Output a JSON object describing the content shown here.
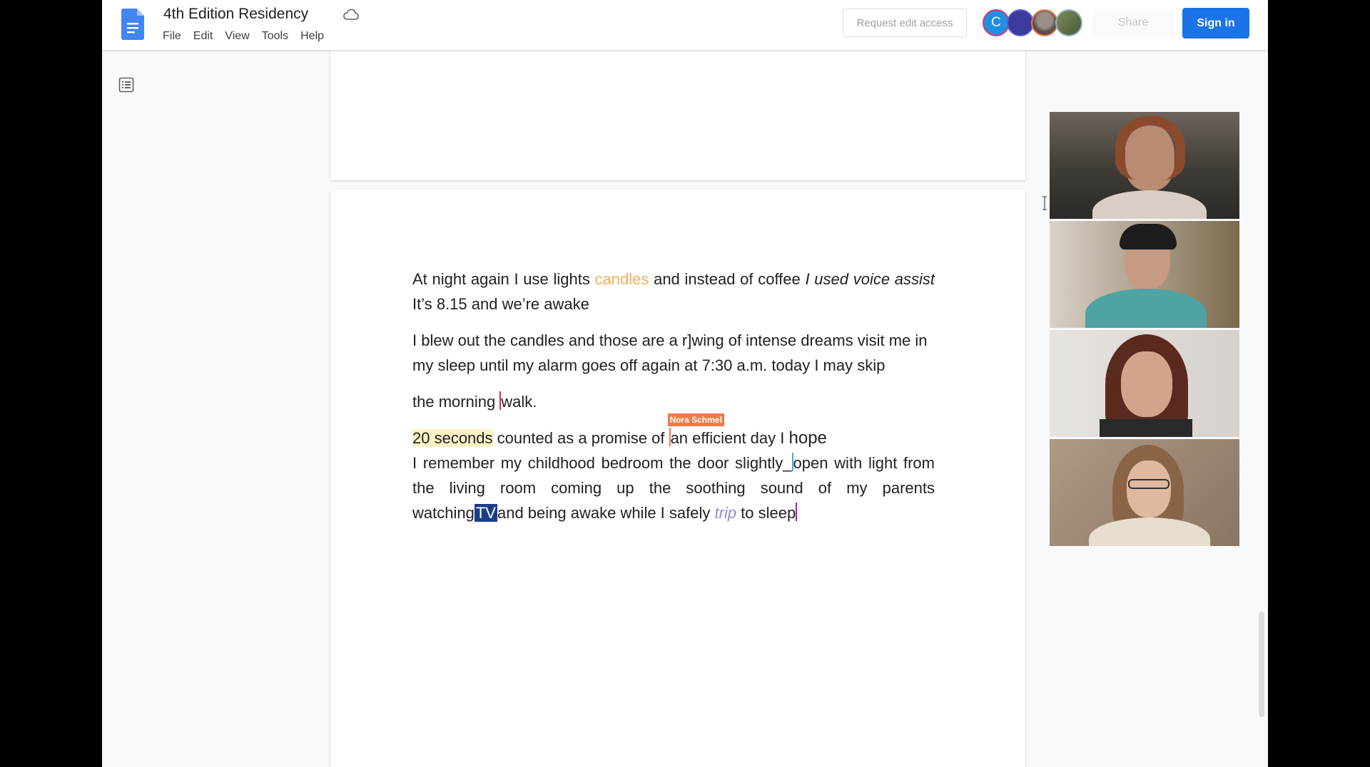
{
  "header": {
    "doc_title": "4th Edition Residency",
    "menu": [
      "File",
      "Edit",
      "View",
      "Tools",
      "Help"
    ],
    "request_edit_label": "Request edit access",
    "share_label": "Share",
    "sign_in_label": "Sign in",
    "avatar_initial": "C",
    "accent": "#1a73e8"
  },
  "document": {
    "p1": {
      "t1": "At night again I use lights ",
      "candles": "candles",
      "t2": " and instead of coffee ",
      "italic": "I used voice assist",
      "t3": " It’s 8.15 and we’re awake"
    },
    "p2": "I blew out the candles and those are a r]wing of intense dreams visit me in my sleep until my alarm goes off again at 7:30 a.m. today I may skip",
    "p3": {
      "a": " the morning ",
      "b": "walk."
    },
    "p4": {
      "highlight": "20 seconds",
      "t1": " counted as a promise of ",
      "t2": "an efficient day I ",
      "hope": "hope",
      "collaborator": "Nora Schmel"
    },
    "p5": {
      "t1": "I remember my childhood bedroom the door slightly_",
      "t2": "open with light from the living room coming up the soothing sound of my parents watching",
      "tv": "TV",
      "t3": "and being awake while I safely ",
      "trip": "trip",
      "t4": " to sleep"
    }
  },
  "video_tiles": [
    "participant-1",
    "participant-2",
    "participant-3",
    "participant-4"
  ]
}
